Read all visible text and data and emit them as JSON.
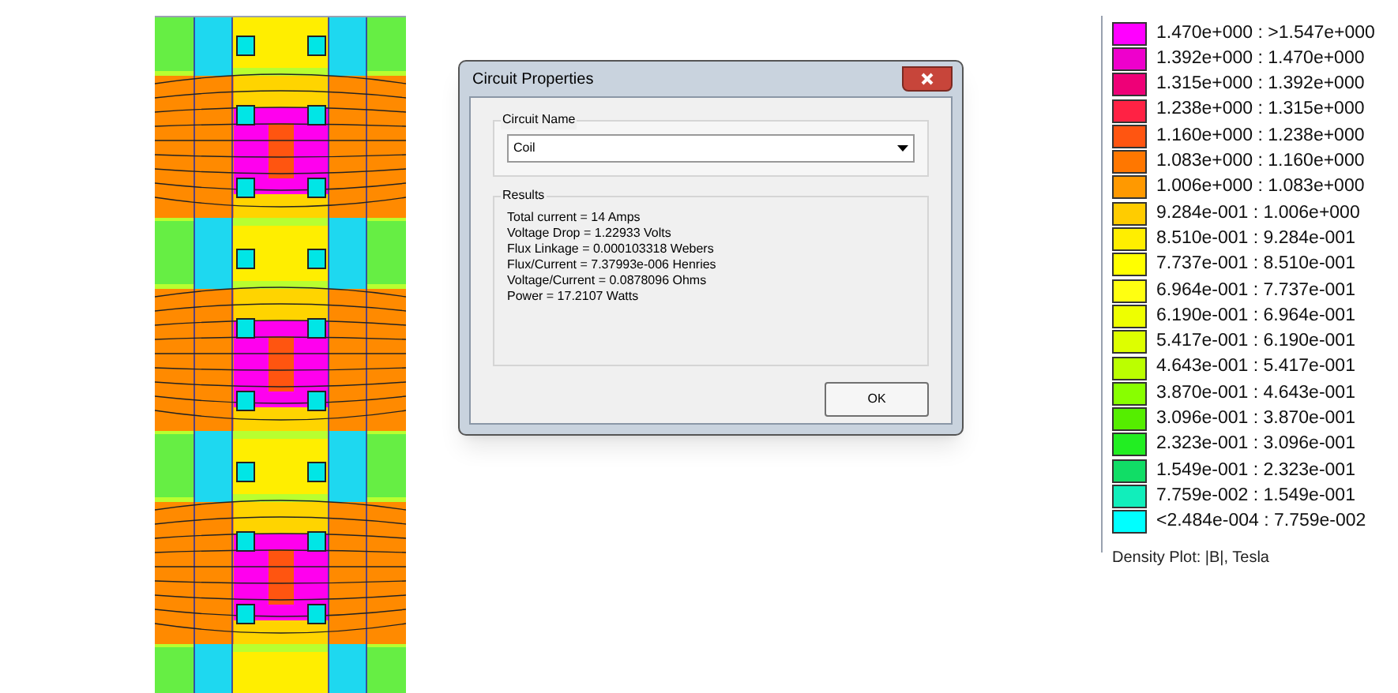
{
  "dialog": {
    "title": "Circuit Properties",
    "circuit_name": {
      "label": "Circuit Name",
      "value": "Coil"
    },
    "results": {
      "label": "Results",
      "lines": [
        "Total current = 14 Amps",
        "Voltage Drop = 1.22933 Volts",
        "Flux Linkage = 0.000103318 Webers",
        "Flux/Current = 7.37993e-006 Henries",
        "Voltage/Current = 0.0878096 Ohms",
        "Power = 17.2107 Watts"
      ]
    },
    "buttons": [
      "OK"
    ]
  },
  "legend": {
    "entries": [
      {
        "range": "1.470e+000 : >1.547e+000",
        "color": "#ff00ff"
      },
      {
        "range": "1.392e+000 : 1.470e+000",
        "color": "#ee00cc"
      },
      {
        "range": "1.315e+000 : 1.392e+000",
        "color": "#ee0077"
      },
      {
        "range": "1.238e+000 : 1.315e+000",
        "color": "#ff2244"
      },
      {
        "range": "1.160e+000 : 1.238e+000",
        "color": "#ff5511"
      },
      {
        "range": "1.083e+000 : 1.160e+000",
        "color": "#ff7700"
      },
      {
        "range": "1.006e+000 : 1.083e+000",
        "color": "#ff9900"
      },
      {
        "range": "9.284e-001 : 1.006e+000",
        "color": "#ffcc00"
      },
      {
        "range": "8.510e-001 : 9.284e-001",
        "color": "#ffee00"
      },
      {
        "range": "7.737e-001 : 8.510e-001",
        "color": "#ffff00"
      },
      {
        "range": "6.964e-001 : 7.737e-001",
        "color": "#ffff11"
      },
      {
        "range": "6.190e-001 : 6.964e-001",
        "color": "#eeff00"
      },
      {
        "range": "5.417e-001 : 6.190e-001",
        "color": "#ddff00"
      },
      {
        "range": "4.643e-001 : 5.417e-001",
        "color": "#bbff00"
      },
      {
        "range": "3.870e-001 : 4.643e-001",
        "color": "#88ff00"
      },
      {
        "range": "3.096e-001 : 3.870e-001",
        "color": "#55ee00"
      },
      {
        "range": "2.323e-001 : 3.096e-001",
        "color": "#22ee22"
      },
      {
        "range": "1.549e-001 : 2.323e-001",
        "color": "#11dd66"
      },
      {
        "range": "7.759e-002 : 1.549e-001",
        "color": "#11eebb"
      },
      {
        "range": "<2.484e-004 : 7.759e-002",
        "color": "#00ffff"
      }
    ],
    "caption": "Density Plot: |B|, Tesla"
  }
}
